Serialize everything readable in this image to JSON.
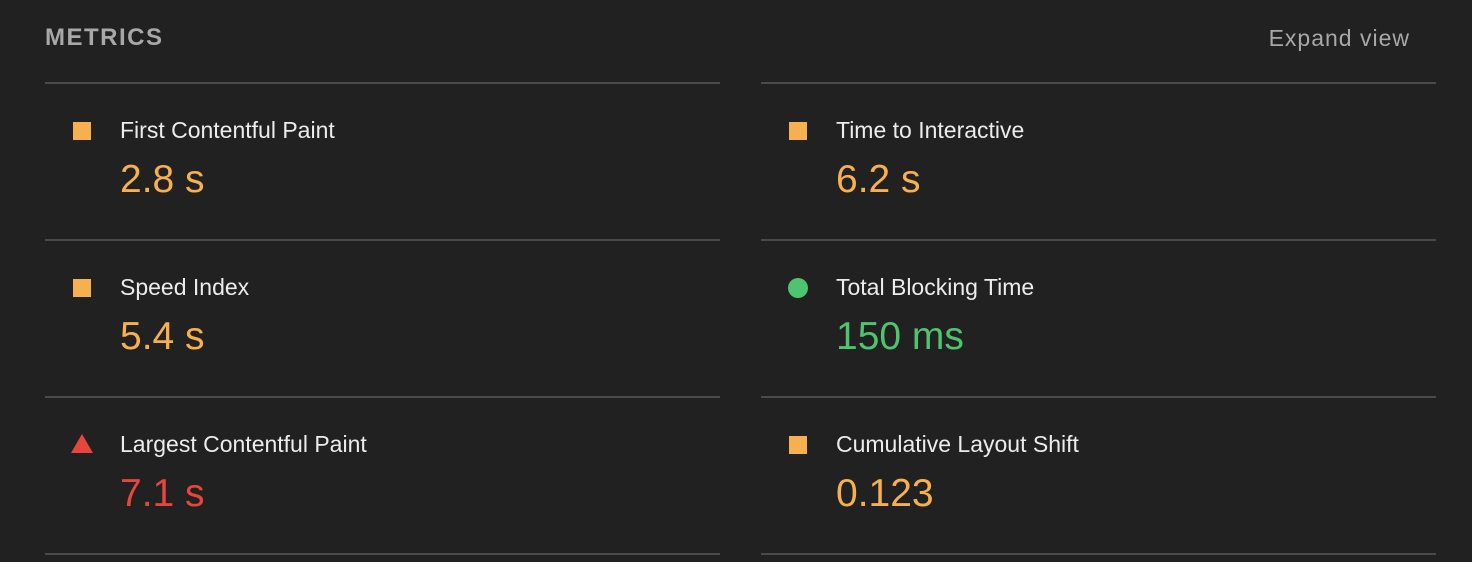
{
  "header": {
    "title": "METRICS",
    "expand_label": "Expand view"
  },
  "colors": {
    "background": "#212121",
    "average": "#f7b04f",
    "pass": "#4fc46e",
    "fail": "#e8453c"
  },
  "metrics": {
    "fcp": {
      "label": "First Contentful Paint",
      "value": "2.8 s",
      "rating": "average",
      "icon": "orange-square-icon"
    },
    "tti": {
      "label": "Time to Interactive",
      "value": "6.2 s",
      "rating": "average",
      "icon": "orange-square-icon"
    },
    "si": {
      "label": "Speed Index",
      "value": "5.4 s",
      "rating": "average",
      "icon": "orange-square-icon"
    },
    "tbt": {
      "label": "Total Blocking Time",
      "value": "150 ms",
      "rating": "pass",
      "icon": "green-circle-icon"
    },
    "lcp": {
      "label": "Largest Contentful Paint",
      "value": "7.1 s",
      "rating": "fail",
      "icon": "red-triangle-icon"
    },
    "cls": {
      "label": "Cumulative Layout Shift",
      "value": "0.123",
      "rating": "average",
      "icon": "orange-square-icon"
    }
  }
}
